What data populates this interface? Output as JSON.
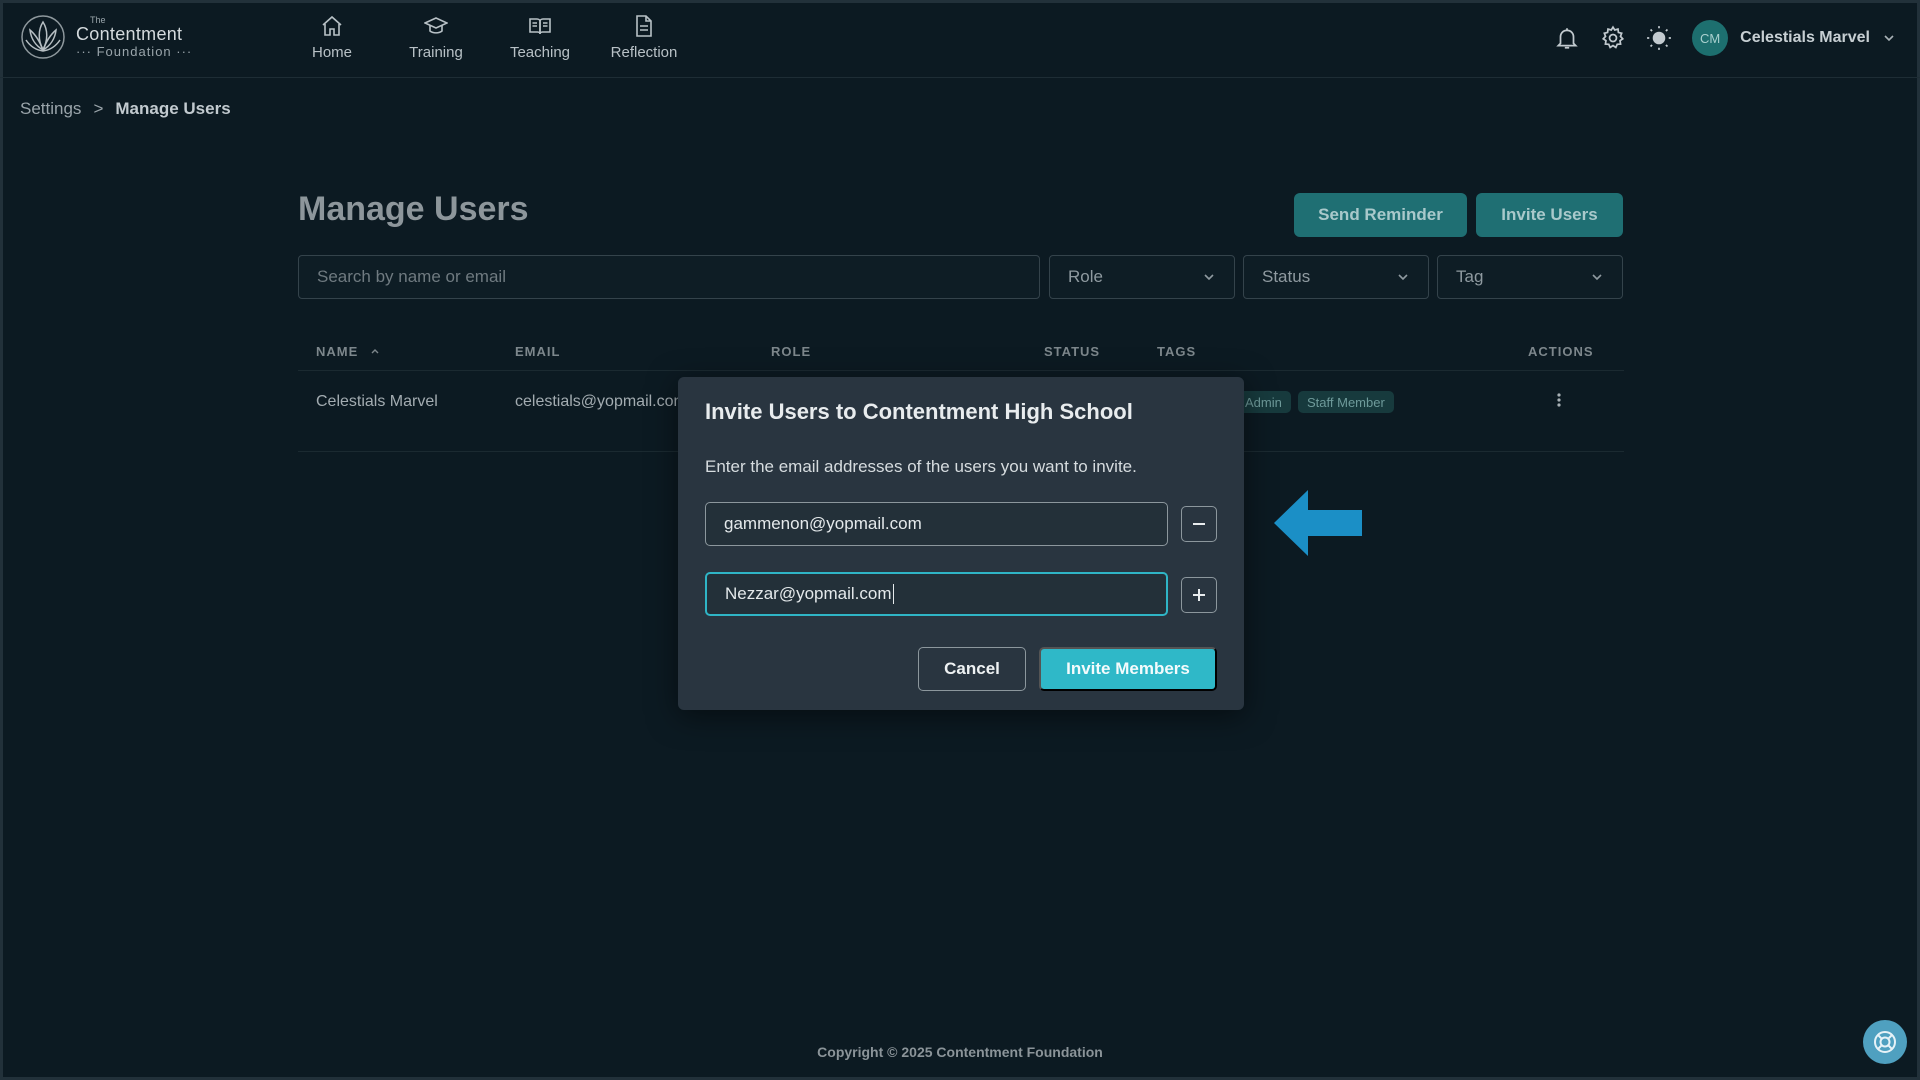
{
  "brand": {
    "small": "The",
    "name": "Contentment",
    "sub": "··· Foundation ···"
  },
  "nav": {
    "items": [
      {
        "label": "Home",
        "icon": "home-icon"
      },
      {
        "label": "Training",
        "icon": "graduation-cap-icon"
      },
      {
        "label": "Teaching",
        "icon": "open-book-icon"
      },
      {
        "label": "Reflection",
        "icon": "document-icon"
      }
    ]
  },
  "user": {
    "initials": "CM",
    "name": "Celestials Marvel"
  },
  "breadcrumb": {
    "parent": "Settings",
    "separator": ">",
    "current": "Manage Users"
  },
  "page": {
    "title": "Manage Users",
    "send_reminder_label": "Send Reminder",
    "invite_users_label": "Invite Users"
  },
  "filters": {
    "search_placeholder": "Search by name or email",
    "role": "Role",
    "status": "Status",
    "tag": "Tag"
  },
  "table": {
    "columns": [
      "NAME",
      "EMAIL",
      "ROLE",
      "STATUS",
      "TAGS",
      "ACTIONS"
    ],
    "rows": [
      {
        "name": "Celestials Marvel",
        "email": "celestials@yopmail.com",
        "tags": [
          "Admin",
          "Staff Member"
        ]
      }
    ]
  },
  "modal": {
    "title": "Invite Users to Contentment High School",
    "description": "Enter the email addresses of the users you want to invite.",
    "emails": [
      "gammenon@yopmail.com",
      "Nezzar@yopmail.com"
    ],
    "cancel_label": "Cancel",
    "submit_label": "Invite Members"
  },
  "footer": {
    "copyright": "Copyright © 2025 Contentment Foundation"
  },
  "colors": {
    "background": "#0c1a22",
    "accent": "#2fb8c8",
    "teal_button": "#1f6f73",
    "arrow": "#1b8fc6"
  }
}
